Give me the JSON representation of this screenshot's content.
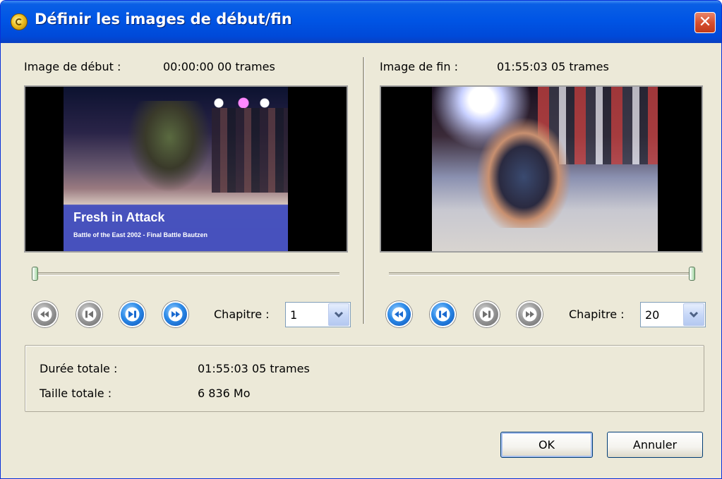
{
  "window": {
    "title": "Définir les images de début/fin",
    "close_icon": "close-icon",
    "app_icon": "app-logo-icon"
  },
  "start": {
    "label": "Image de début :",
    "timecode": "00:00:00 00 trames",
    "caption_title": "Fresh in Attack",
    "caption_subtitle": "Battle of the East 2002 - Final Battle Bautzen",
    "slider_position": 0,
    "chapter_label": "Chapitre :",
    "chapter_value": "1",
    "buttons": [
      {
        "icon": "rewind-icon",
        "state": "disabled"
      },
      {
        "icon": "step-back-icon",
        "state": "disabled"
      },
      {
        "icon": "step-forward-icon",
        "state": "enabled"
      },
      {
        "icon": "fast-forward-icon",
        "state": "enabled"
      }
    ]
  },
  "end": {
    "label": "Image de fin :",
    "timecode": "01:55:03 05 trames",
    "slider_position": 1,
    "chapter_label": "Chapitre :",
    "chapter_value": "20",
    "buttons": [
      {
        "icon": "rewind-icon",
        "state": "enabled"
      },
      {
        "icon": "step-back-icon",
        "state": "enabled"
      },
      {
        "icon": "step-forward-icon",
        "state": "disabled"
      },
      {
        "icon": "fast-forward-icon",
        "state": "disabled"
      }
    ]
  },
  "summary": {
    "duration_label": "Durée totale :",
    "duration_value": "01:55:03 05 trames",
    "size_label": "Taille totale :",
    "size_value": "6 836 Mo"
  },
  "footer": {
    "ok_label": "OK",
    "cancel_label": "Annuler"
  },
  "colors": {
    "titlebar": "#0055e5",
    "dialog_bg": "#ece9d8",
    "button_blue": "#2c8ae8",
    "button_gray": "#9a9a9a"
  }
}
